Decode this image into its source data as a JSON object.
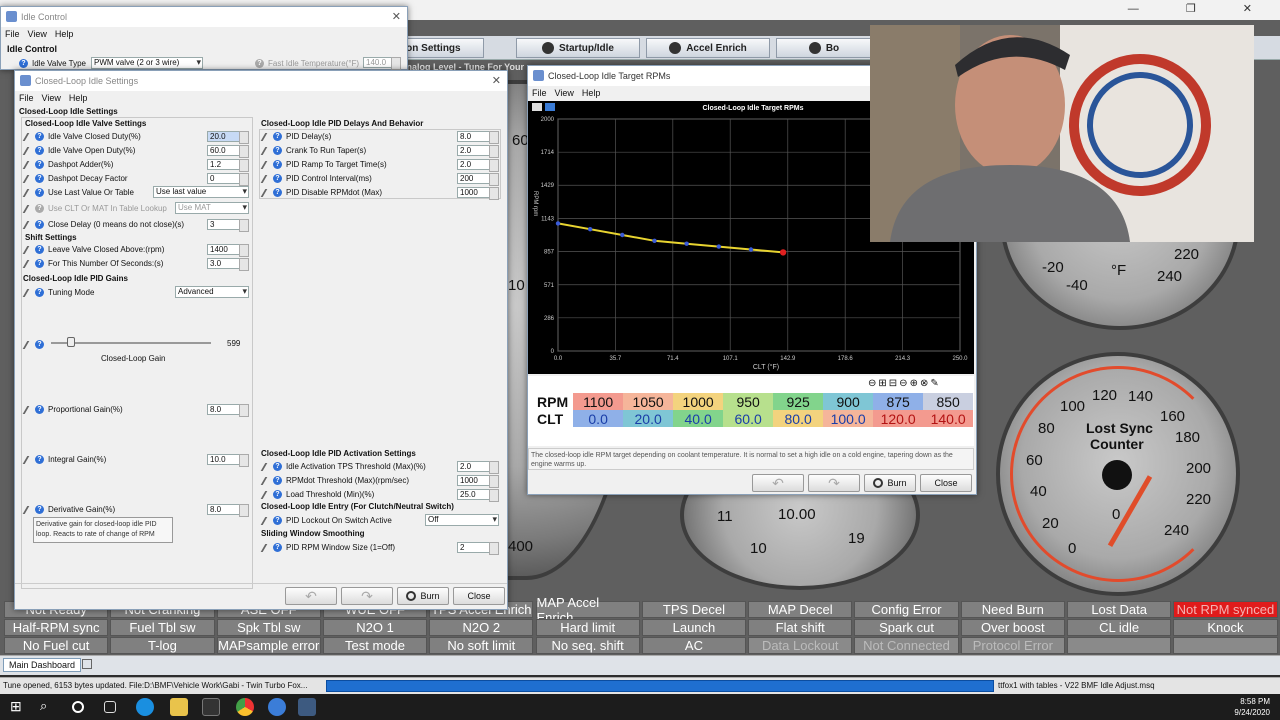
{
  "main": {
    "title_hidden": "",
    "toolbar": {
      "buttons": [
        "ion Settings",
        "Startup/Idle",
        "Accel Enrich",
        "Bo"
      ],
      "dash_text": "Analog Level - Tune For Your"
    },
    "gauges": {
      "left_partial": [
        "60",
        "10",
        "400"
      ],
      "clt_gauge": {
        "labels": [
          "-20",
          "-40",
          "°F",
          "220",
          "240"
        ]
      },
      "sync_gauge": {
        "title": "Lost Sync",
        "title2": "Counter",
        "labels": [
          "100",
          "120",
          "140",
          "80",
          "160",
          "60",
          "180",
          "40",
          "200",
          "20",
          "220",
          "0",
          "240",
          "0"
        ]
      },
      "mid_gauge": {
        "labels": [
          "11",
          "10.00",
          "19",
          "10"
        ]
      }
    },
    "indicators": [
      [
        "Not Ready",
        "Not Cranking",
        "ASE OFF",
        "WUE OFF",
        "TPS Accel Enrich",
        "MAP Accel Enrich",
        "TPS Decel",
        "MAP Decel",
        "Config Error",
        "Need Burn",
        "Lost Data",
        "Not RPM synced"
      ],
      [
        "Half-RPM sync",
        "Fuel Tbl sw",
        "Spk Tbl sw",
        "N2O 1",
        "N2O 2",
        "Hard limit",
        "Launch",
        "Flat shift",
        "Spark cut",
        "Over boost",
        "CL idle",
        "Knock"
      ],
      [
        "No Fuel cut",
        "T-log",
        "MAPsample error",
        "Test mode",
        "No soft limit",
        "No seq. shift",
        "AC",
        "Data Lockout",
        "Not Connected",
        "Protocol Error",
        "",
        ""
      ]
    ],
    "main_tab": "Main Dashboard",
    "status_left": "Tune opened, 6153 bytes updated. File:D:\\BMF\\Vehicle Work\\Gabi - Twin Turbo Fox...",
    "status_right": "ttfox1 with tables - V22 BMF Idle Adjust.msq",
    "clock_time": "8:58 PM",
    "clock_date": "9/24/2020"
  },
  "idle_control": {
    "title": "Idle Control",
    "menu": [
      "File",
      "View",
      "Help"
    ],
    "section": "Idle Control",
    "valve_type_label": "Idle Valve Type",
    "valve_type_value": "PWM valve (2 or 3 wire)",
    "fast_idle_label": "Fast Idle Temperature(°F)",
    "fast_idle_value": "140.0"
  },
  "cl_settings": {
    "title": "Closed-Loop Idle Settings",
    "menu": [
      "File",
      "View",
      "Help"
    ],
    "header": "Closed-Loop Idle Settings",
    "valve_section": "Closed-Loop Idle Valve Settings",
    "valve_rows": [
      {
        "label": "Idle Valve Closed Duty(%)",
        "value": "20.0"
      },
      {
        "label": "Idle Valve Open Duty(%)",
        "value": "60.0"
      },
      {
        "label": "Dashpot Adder(%)",
        "value": "1.2"
      },
      {
        "label": "Dashpot Decay Factor",
        "value": "0"
      }
    ],
    "use_last_label": "Use Last Value Or Table",
    "use_last_value": "Use last value",
    "use_clt_label": "Use CLT Or MAT In Table Lookup",
    "use_clt_value": "Use MAT",
    "close_delay_label": "Close Delay (0 means do not close)(s)",
    "close_delay_value": "3",
    "shift_section": "Shift Settings",
    "shift_rows": [
      {
        "label": "Leave Valve Closed Above:(rpm)",
        "value": "1400"
      },
      {
        "label": "For This Number Of Seconds:(s)",
        "value": "3.0"
      }
    ],
    "gains_section": "Closed-Loop Idle PID Gains",
    "tuning_mode_label": "Tuning Mode",
    "tuning_mode_value": "Advanced",
    "slider_value": "599",
    "slider_label": "Closed-Loop Gain",
    "proportional_label": "Proportional Gain(%)",
    "proportional_value": "8.0",
    "integral_label": "Integral Gain(%)",
    "integral_value": "10.0",
    "derivative_label": "Derivative Gain(%)",
    "derivative_value": "8.0",
    "tooltip": "Derivative gain for closed-loop idle PID loop. Reacts to rate of change of RPM",
    "delays_section": "Closed-Loop Idle PID Delays And Behavior",
    "delay_rows": [
      {
        "label": "PID Delay(s)",
        "value": "8.0"
      },
      {
        "label": "Crank To Run Taper(s)",
        "value": "2.0"
      },
      {
        "label": "PID Ramp To Target Time(s)",
        "value": "2.0"
      },
      {
        "label": "PID Control Interval(ms)",
        "value": "200"
      },
      {
        "label": "PID Disable RPMdot (Max)",
        "value": "1000"
      }
    ],
    "activation_section": "Closed-Loop Idle PID Activation Settings",
    "activation_rows": [
      {
        "label": "Idle Activation TPS Threshold (Max)(%)",
        "value": "2.0"
      },
      {
        "label": "RPMdot Threshold (Max)(rpm/sec)",
        "value": "1000"
      },
      {
        "label": "Load Threshold (Min)(%)",
        "value": "25.0"
      }
    ],
    "entry_section": "Closed-Loop Idle Entry (For Clutch/Neutral Switch)",
    "lockout_label": "PID Lockout On Switch Active",
    "lockout_value": "Off",
    "smoothing_section": "Sliding Window Smoothing",
    "window_label": "PID RPM Window Size (1=Off)",
    "window_value": "2",
    "burn_label": "Burn",
    "close_label": "Close"
  },
  "target_win": {
    "title": "Closed-Loop Idle Target RPMs",
    "menu": [
      "File",
      "View",
      "Help"
    ],
    "description": "The closed-loop idle RPM target depending on coolant temperature. It is normal to set a high idle on a cold engine, tapering down as the engine warms up.",
    "row_rpm_label": "RPM",
    "row_clt_label": "CLT",
    "rpm_values": [
      "1100",
      "1050",
      "1000",
      "950",
      "925",
      "900",
      "875",
      "850"
    ],
    "clt_values": [
      "0.0",
      "20.0",
      "40.0",
      "60.0",
      "80.0",
      "100.0",
      "120.0",
      "140.0"
    ],
    "rpm_colors": [
      "#f39a8f",
      "#f5b59a",
      "#f3d37e",
      "#b7e08d",
      "#82d48c",
      "#7fc6d5",
      "#8fb0e8",
      "#c9cfe0"
    ],
    "clt_colors": [
      "#8fb0e8",
      "#7fc6d5",
      "#82d48c",
      "#b7e08d",
      "#f3d37e",
      "#f5b59a",
      "#f39a8f",
      "#f39a8f"
    ],
    "burn_label": "Burn",
    "close_label": "Close"
  },
  "chart_data": {
    "type": "line",
    "title": "Closed-Loop Idle Target RPMs",
    "xlabel": "CLT (°F)",
    "ylabel": "RPM rpm",
    "x_ticks": [
      "0.0",
      "35.7",
      "71.4",
      "107.1",
      "142.9",
      "178.6",
      "214.3",
      "250.0"
    ],
    "y_ticks": [
      "2000",
      "1714",
      "1429",
      "1143",
      "857",
      "571",
      "286",
      "0"
    ],
    "xlim": [
      0,
      250
    ],
    "ylim": [
      0,
      2000
    ],
    "grid": true,
    "x": [
      0,
      20,
      40,
      60,
      80,
      100,
      120,
      140
    ],
    "series": [
      {
        "values": [
          1100,
          1050,
          1000,
          950,
          925,
          900,
          875,
          850
        ]
      }
    ],
    "line_color": "#e8d430",
    "point_color": "#3a5bd8",
    "selected_point_color": "#e02020"
  }
}
